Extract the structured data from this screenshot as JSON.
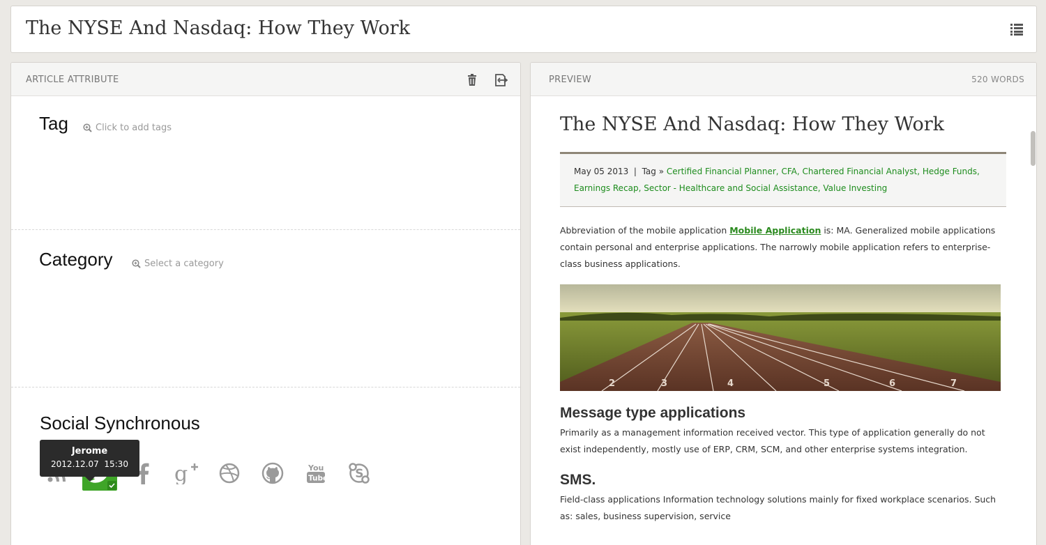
{
  "header": {
    "title": "The NYSE And Nasdaq: How They Work",
    "menu_icon": "list-icon"
  },
  "left_panel": {
    "heading": "ARTICLE ATTRIBUTE",
    "delete_icon": "trash-icon",
    "export_icon": "export-icon",
    "tag": {
      "title": "Tag",
      "hint": "Click to add tags"
    },
    "category": {
      "title": "Category",
      "hint": "Select a category"
    },
    "social": {
      "title": "Social Synchronous",
      "networks": [
        "rss",
        "twitter",
        "facebook",
        "google-plus",
        "dribbble",
        "github",
        "youtube",
        "skype"
      ],
      "active": "twitter",
      "active_color": "#3fa528",
      "tooltip": {
        "name": "Jerome",
        "date": "2012.12.07  15:30"
      }
    }
  },
  "preview": {
    "heading": "PREVIEW",
    "word_count": "520 WORDS",
    "title": "The NYSE And Nasdaq: How They Work",
    "meta": {
      "date": "May 05 2013",
      "separator": "|",
      "tag_label": "Tag »",
      "tags": "Certified Financial Planner, CFA, Chartered Financial Analyst, Hedge Funds, Earnings Recap, Sector - Healthcare and Social Assistance, Value Investing",
      "tag_color": "#1d8c1d"
    },
    "intro_before": "Abbreviation of the mobile application ",
    "intro_link": "Mobile Application",
    "intro_after": " is: MA. Generalized mobile applications contain personal and enterprise applications. The narrowly mobile application refers to enterprise-class business applications.",
    "section1_title": "Message type applications",
    "section1_text": "Primarily as a management information received vector. This type of application generally do not exist independently, mostly use of ERP, CRM, SCM, and other enterprise systems integration.",
    "section2_title": "SMS.",
    "section2_text": "Field-class applications Information technology solutions mainly for fixed workplace scenarios. Such as: sales, business supervision, service"
  }
}
